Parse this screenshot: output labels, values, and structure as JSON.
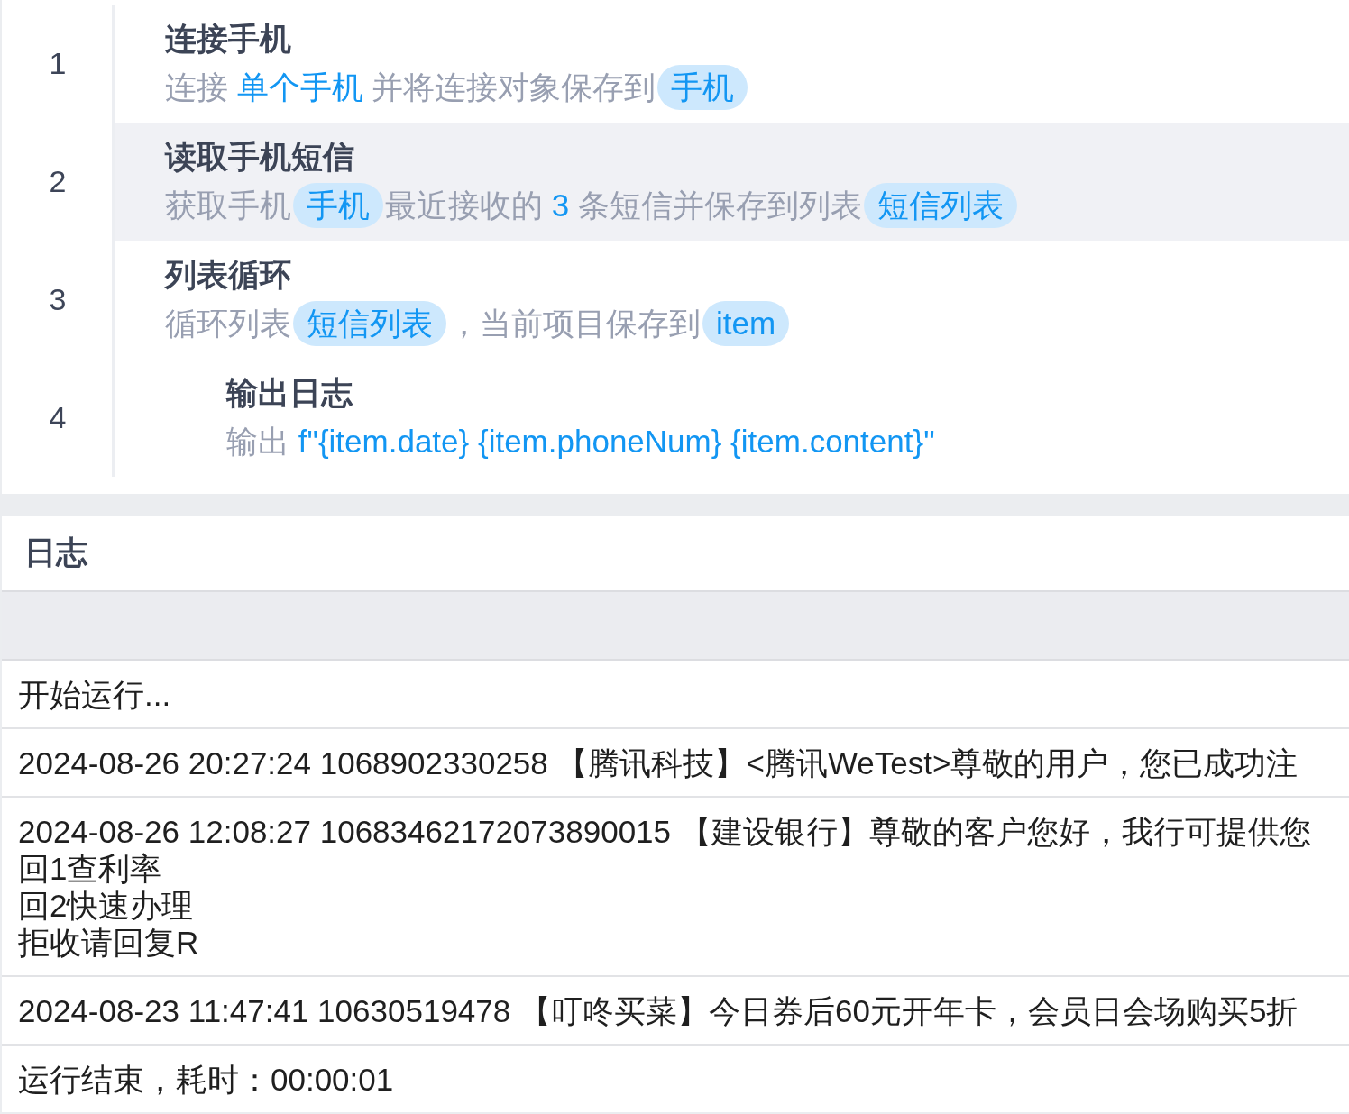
{
  "steps": [
    {
      "number": "1",
      "title": "连接手机",
      "selected": false,
      "description": [
        {
          "kind": "text",
          "text": "连接 "
        },
        {
          "kind": "value",
          "text": "单个手机"
        },
        {
          "kind": "text",
          "text": " 并将连接对象保存到"
        },
        {
          "kind": "variable",
          "text": "手机"
        }
      ]
    },
    {
      "number": "2",
      "title": "读取手机短信",
      "selected": true,
      "description": [
        {
          "kind": "text",
          "text": "获取手机"
        },
        {
          "kind": "variable",
          "text": "手机"
        },
        {
          "kind": "text",
          "text": "最近接收的 "
        },
        {
          "kind": "value",
          "text": "3"
        },
        {
          "kind": "text",
          "text": " 条短信并保存到列表"
        },
        {
          "kind": "variable",
          "text": "短信列表"
        }
      ]
    },
    {
      "number": "3",
      "title": "列表循环",
      "selected": false,
      "description": [
        {
          "kind": "text",
          "text": "循环列表"
        },
        {
          "kind": "variable",
          "text": "短信列表"
        },
        {
          "kind": "text",
          "text": "，当前项目保存到"
        },
        {
          "kind": "variable",
          "text": "item"
        }
      ],
      "children": [
        {
          "number": "4",
          "title": "输出日志",
          "selected": false,
          "description": [
            {
              "kind": "text",
              "text": "输出 "
            },
            {
              "kind": "value",
              "text": "f\"{item.date} {item.phoneNum} {item.content}\""
            }
          ]
        }
      ]
    }
  ],
  "log": {
    "title": "日志",
    "entries": [
      {
        "lines": [
          "开始运行..."
        ]
      },
      {
        "lines": [
          "2024-08-26 20:27:24 1068902330258 【腾讯科技】<腾讯WeTest>尊敬的用户，您已成功注"
        ]
      },
      {
        "lines": [
          "2024-08-26 12:08:27 10683462172073890015 【建设银行】尊敬的客户您好，我行可提供您",
          "回1查利率",
          "回2快速办理",
          "拒收请回复R"
        ]
      },
      {
        "lines": [
          "2024-08-23 11:47:41 10630519478 【叮咚买菜】今日券后60元开年卡，会员日会场购买5折"
        ]
      },
      {
        "lines": [
          "运行结束，耗时：00:00:01"
        ]
      }
    ]
  }
}
